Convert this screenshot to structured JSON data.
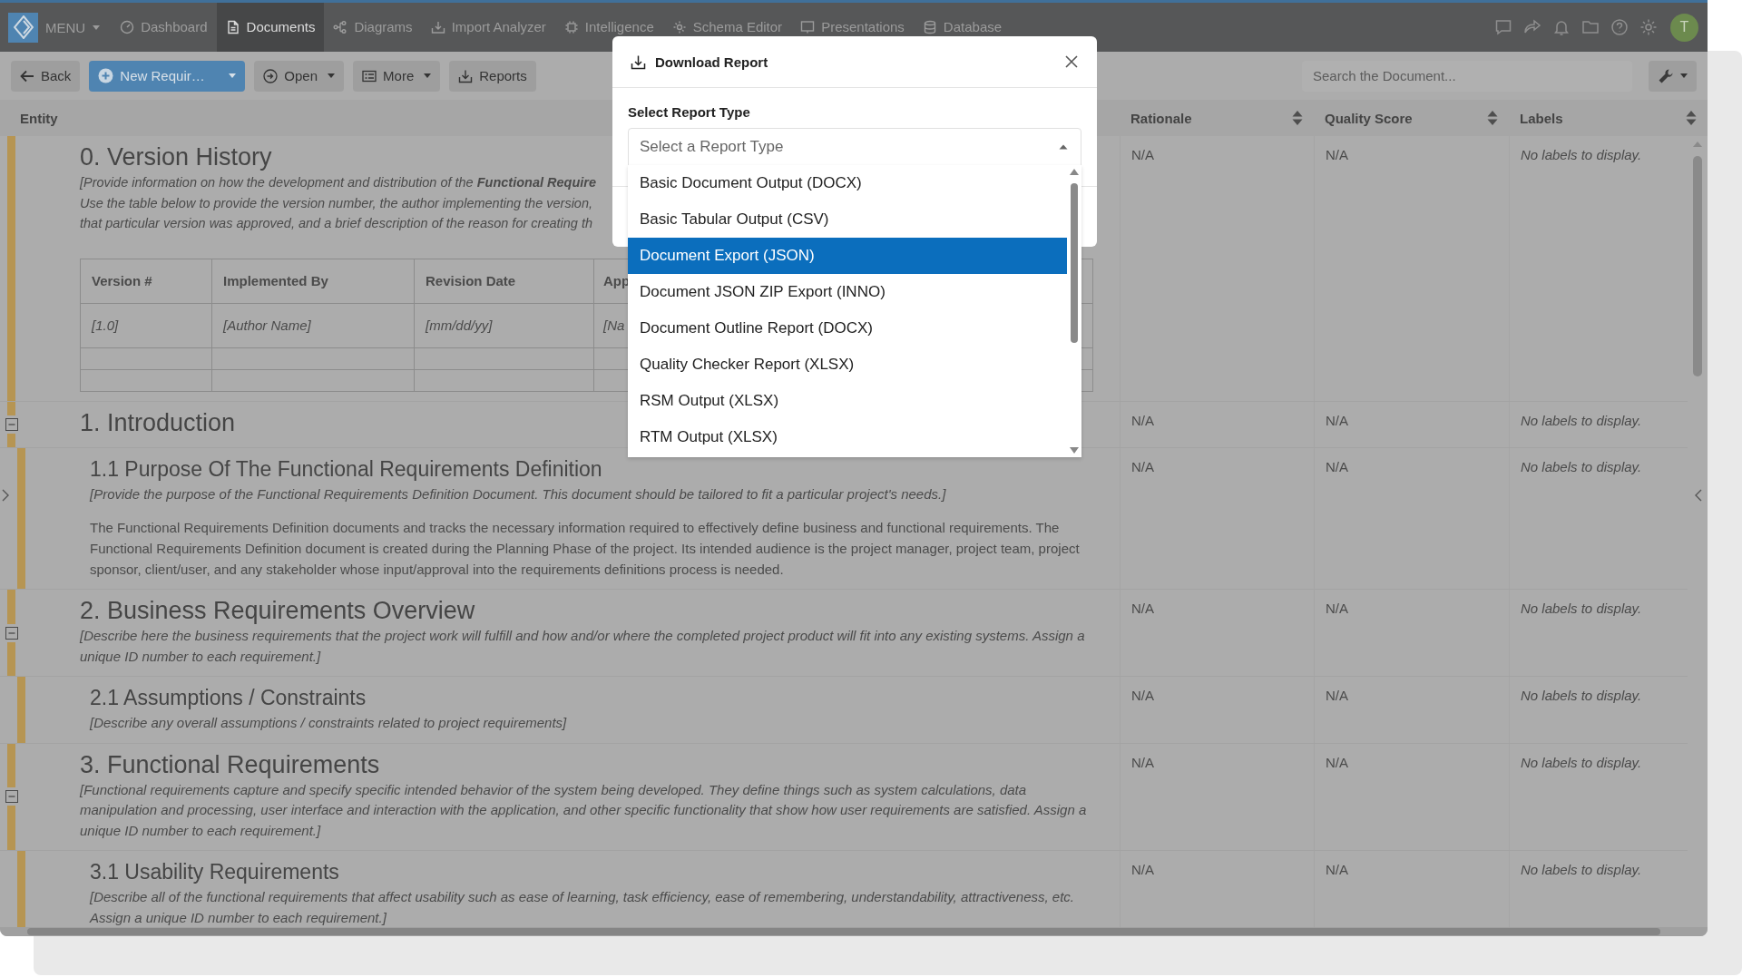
{
  "nav": {
    "menu": "MENU",
    "items": [
      {
        "label": "Dashboard",
        "selected": false
      },
      {
        "label": "Documents",
        "selected": true
      },
      {
        "label": "Diagrams",
        "selected": false
      },
      {
        "label": "Import Analyzer",
        "selected": false
      },
      {
        "label": "Intelligence",
        "selected": false
      },
      {
        "label": "Schema Editor",
        "selected": false
      },
      {
        "label": "Presentations",
        "selected": false
      },
      {
        "label": "Database",
        "selected": false
      }
    ],
    "avatar": "T"
  },
  "toolbar": {
    "back": "Back",
    "new": "New Requir…",
    "open": "Open",
    "more": "More",
    "reports": "Reports",
    "search": {
      "placeholder": "Search the Document..."
    }
  },
  "table": {
    "columns": [
      {
        "label": "Entity",
        "sortable": false
      },
      {
        "label": "Rationale",
        "sortable": true
      },
      {
        "label": "Quality Score",
        "sortable": true
      },
      {
        "label": "Labels",
        "sortable": true
      }
    ],
    "sections": [
      {
        "heading": "0. Version History",
        "lines": [
          "[Provide information on how the development and distribution of the **Functional Require**",
          "Use the table below to provide the version number, the author implementing the version,",
          "that particular version was approved, and a brief description of the reason for creating th"
        ],
        "version_table": {
          "columns": [
            "Version #",
            "Implemented By",
            "Revision Date",
            "App"
          ],
          "cells": [
            "[1.0]",
            "[Author Name]",
            "[mm/dd/yy]",
            "[Na"
          ]
        },
        "rationale": "N/A",
        "quality_score": "N/A",
        "labels": "No labels to display."
      },
      {
        "heading": "1. Introduction",
        "expanded": true,
        "rationale": "N/A",
        "quality_score": "N/A",
        "labels": "No labels to display.",
        "children": [
          {
            "heading": "1.1 Purpose Of The Functional Requirements Definition",
            "description": "[Provide the purpose of the Functional Requirements Definition Document. This document should be tailored to fit a particular project's needs.]",
            "body": "The Functional Requirements Definition documents and tracks the necessary information required to effectively define business and functional requirements. The Functional Requirements Definition document is created during the Planning Phase of the project. Its intended audience is the project manager, project team, project sponsor, client/user, and any stakeholder whose input/approval into the requirements definitions process is needed.",
            "rationale": "N/A",
            "quality_score": "N/A",
            "labels": "No labels to display."
          }
        ]
      },
      {
        "heading": "2. Business Requirements Overview",
        "expanded": true,
        "description": "[Describe here the business requirements that the project work will fulfill and how and/or where the completed project product will fit into any existing systems. Assign a unique ID number to each requirement.]",
        "rationale": "N/A",
        "quality_score": "N/A",
        "labels": "No labels to display.",
        "children": [
          {
            "heading": "2.1 Assumptions / Constraints",
            "description": "[Describe any overall assumptions / constraints related to project requirements]",
            "rationale": "N/A",
            "quality_score": "N/A",
            "labels": "No labels to display."
          }
        ]
      },
      {
        "heading": "3. Functional Requirements",
        "expanded": true,
        "description": "[Functional requirements capture and specify specific intended behavior of the system being developed. They define things such as system calculations, data manipulation and processing, user interface and interaction with the application, and other specific functionality that show how user requirements are satisfied. Assign a unique ID number to each requirement.]",
        "rationale": "N/A",
        "quality_score": "N/A",
        "labels": "No labels to display.",
        "children": [
          {
            "heading": "3.1 Usability Requirements",
            "description": "[Describe all of the functional requirements that affect usability such as ease of learning, task efficiency, ease of remembering, understandability, attractiveness, etc. Assign a unique ID number to each requirement.]",
            "rationale": "N/A",
            "quality_score": "N/A",
            "labels": "No labels to display."
          }
        ]
      }
    ]
  },
  "dialog": {
    "title": "Download Report",
    "field_label": "Select Report Type",
    "select": {
      "placeholder": "Select a Report Type",
      "expanded": true
    },
    "options": [
      {
        "label": "Basic Document Output (DOCX)",
        "selected": false
      },
      {
        "label": "Basic Tabular Output (CSV)",
        "selected": false
      },
      {
        "label": "Document Export (JSON)",
        "selected": true
      },
      {
        "label": "Document JSON ZIP Export (INNO)",
        "selected": false
      },
      {
        "label": "Document Outline Report (DOCX)",
        "selected": false
      },
      {
        "label": "Quality Checker Report (XLSX)",
        "selected": false
      },
      {
        "label": "RSM Output (XLSX)",
        "selected": false
      },
      {
        "label": "RTM Output (XLSX)",
        "selected": false
      }
    ]
  }
}
